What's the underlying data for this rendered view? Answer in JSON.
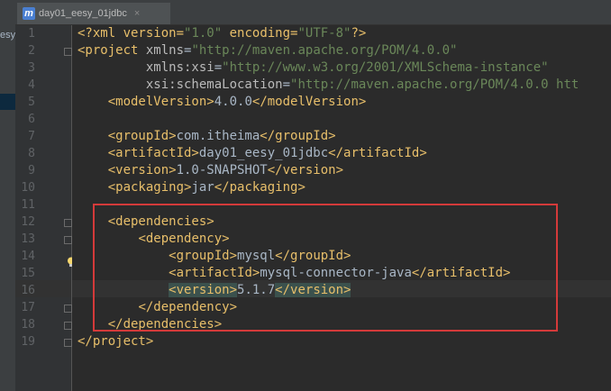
{
  "window": {
    "sidebar_label": "esy_",
    "tab": {
      "label": "day01_eesy_01jdbc",
      "icon": "maven-m-icon",
      "close": "×"
    }
  },
  "editor": {
    "caret_line": 16,
    "lines": [
      {
        "n": "1",
        "fold": false,
        "parts": [
          [
            "pi",
            "<?xml version="
          ],
          [
            "val",
            "\"1.0\""
          ],
          [
            "pi",
            " encoding="
          ],
          [
            "val",
            "\"UTF-8\""
          ],
          [
            "pi",
            "?>"
          ]
        ]
      },
      {
        "n": "2",
        "fold": true,
        "parts": [
          [
            "tag",
            "<project "
          ],
          [
            "attr",
            "xmlns"
          ],
          [
            "txt",
            "="
          ],
          [
            "val",
            "\"http://maven.apache.org/POM/4.0.0\""
          ]
        ]
      },
      {
        "n": "3",
        "fold": false,
        "parts": [
          [
            "txt",
            "         "
          ],
          [
            "attr",
            "xmlns:xsi"
          ],
          [
            "txt",
            "="
          ],
          [
            "val",
            "\"http://www.w3.org/2001/XMLSchema-instance\""
          ]
        ]
      },
      {
        "n": "4",
        "fold": false,
        "parts": [
          [
            "txt",
            "         "
          ],
          [
            "attr",
            "xsi:schemaLocation"
          ],
          [
            "txt",
            "="
          ],
          [
            "val",
            "\"http://maven.apache.org/POM/4.0.0 htt"
          ]
        ]
      },
      {
        "n": "5",
        "fold": false,
        "parts": [
          [
            "txt",
            "    "
          ],
          [
            "tag",
            "<modelVersion>"
          ],
          [
            "txt",
            "4.0.0"
          ],
          [
            "tag",
            "</modelVersion>"
          ]
        ]
      },
      {
        "n": "6",
        "fold": false,
        "parts": []
      },
      {
        "n": "7",
        "fold": false,
        "parts": [
          [
            "txt",
            "    "
          ],
          [
            "tag",
            "<groupId>"
          ],
          [
            "txt",
            "com.itheima"
          ],
          [
            "tag",
            "</groupId>"
          ]
        ]
      },
      {
        "n": "8",
        "fold": false,
        "parts": [
          [
            "txt",
            "    "
          ],
          [
            "tag",
            "<artifactId>"
          ],
          [
            "txt",
            "day01_eesy_01jdbc"
          ],
          [
            "tag",
            "</artifactId>"
          ]
        ]
      },
      {
        "n": "9",
        "fold": false,
        "parts": [
          [
            "txt",
            "    "
          ],
          [
            "tag",
            "<version>"
          ],
          [
            "txt",
            "1.0-SNAPSHOT"
          ],
          [
            "tag",
            "</version>"
          ]
        ]
      },
      {
        "n": "10",
        "fold": false,
        "parts": [
          [
            "txt",
            "    "
          ],
          [
            "tag",
            "<packaging>"
          ],
          [
            "txt",
            "jar"
          ],
          [
            "tag",
            "</packaging>"
          ]
        ]
      },
      {
        "n": "11",
        "fold": false,
        "parts": []
      },
      {
        "n": "12",
        "fold": true,
        "parts": [
          [
            "txt",
            "    "
          ],
          [
            "tag",
            "<dependencies>"
          ]
        ]
      },
      {
        "n": "13",
        "fold": true,
        "parts": [
          [
            "txt",
            "        "
          ],
          [
            "tag",
            "<dependency>"
          ]
        ]
      },
      {
        "n": "14",
        "fold": false,
        "parts": [
          [
            "txt",
            "            "
          ],
          [
            "tag",
            "<groupId>"
          ],
          [
            "txt",
            "mysql"
          ],
          [
            "tag",
            "</groupId>"
          ]
        ]
      },
      {
        "n": "15",
        "fold": false,
        "parts": [
          [
            "txt",
            "            "
          ],
          [
            "tag",
            "<artifactId>"
          ],
          [
            "txt",
            "mysql-connector-java"
          ],
          [
            "tag",
            "</artifactId>"
          ]
        ]
      },
      {
        "n": "16",
        "fold": false,
        "parts": [
          [
            "txt",
            "            "
          ],
          [
            "tag hl",
            "<version>"
          ],
          [
            "txt",
            "5.1.7"
          ],
          [
            "tag hl",
            "</version>"
          ]
        ]
      },
      {
        "n": "17",
        "fold": true,
        "parts": [
          [
            "txt",
            "        "
          ],
          [
            "tag",
            "</dependency>"
          ]
        ]
      },
      {
        "n": "18",
        "fold": true,
        "parts": [
          [
            "txt",
            "    "
          ],
          [
            "tag",
            "</dependencies>"
          ]
        ]
      },
      {
        "n": "19",
        "fold": true,
        "parts": [
          [
            "tag",
            "</project>"
          ]
        ]
      }
    ]
  },
  "colors": {
    "background": "#2b2b2b",
    "tag": "#e8bf6a",
    "attribute": "#bababa",
    "string": "#6a8759",
    "text": "#a9b7c6",
    "annotation_box": "#d43a3a"
  }
}
